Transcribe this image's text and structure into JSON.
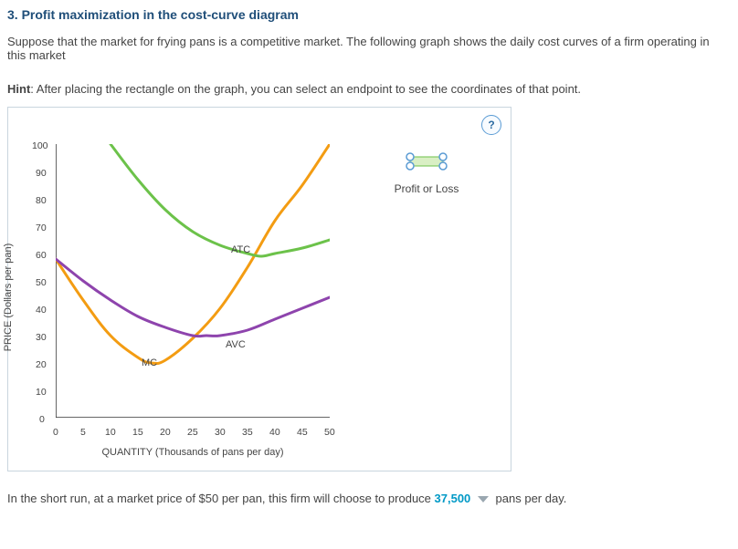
{
  "heading": "3. Profit maximization in the cost-curve diagram",
  "intro": "Suppose that the market for frying pans is a competitive market. The following graph shows the daily cost curves of a firm operating in this market",
  "hint_label": "Hint",
  "hint_text": ": After placing the rectangle on the graph, you can select an endpoint to see the coordinates of that point.",
  "help_symbol": "?",
  "axis": {
    "y_title": "PRICE (Dollars per pan)",
    "x_title": "QUANTITY (Thousands of pans per day)",
    "y_ticks": [
      "0",
      "10",
      "20",
      "30",
      "40",
      "50",
      "60",
      "70",
      "80",
      "90",
      "100"
    ],
    "x_ticks": [
      "0",
      "5",
      "10",
      "15",
      "20",
      "25",
      "30",
      "35",
      "40",
      "45",
      "50"
    ]
  },
  "curve_labels": {
    "atc": "ATC",
    "avc": "AVC",
    "mc": "MC"
  },
  "legend": {
    "label": "Profit or Loss"
  },
  "answer": {
    "prefix": "In the short run, at a market price of $50 per pan, this firm will choose to produce ",
    "value": "37,500",
    "suffix": " pans per day."
  },
  "chart_data": {
    "type": "line",
    "xlabel": "QUANTITY (Thousands of pans per day)",
    "ylabel": "PRICE (Dollars per pan)",
    "xlim": [
      0,
      50
    ],
    "ylim": [
      0,
      100
    ],
    "series": [
      {
        "name": "MC",
        "color": "#f39c12",
        "x": [
          0,
          5,
          10,
          15,
          17.5,
          20,
          25,
          30,
          35,
          40,
          45,
          50
        ],
        "values": [
          58,
          43,
          30,
          22,
          20,
          21,
          29,
          40,
          55,
          72,
          85,
          100
        ]
      },
      {
        "name": "ATC",
        "color": "#6cc24a",
        "x": [
          10,
          15,
          20,
          25,
          30,
          35,
          37.5,
          40,
          45,
          50
        ],
        "values": [
          100,
          87,
          76,
          68,
          63,
          60,
          59,
          60,
          62,
          65
        ]
      },
      {
        "name": "AVC",
        "color": "#8e44ad",
        "x": [
          0,
          5,
          10,
          15,
          20,
          25,
          27.5,
          30,
          35,
          40,
          45,
          50
        ],
        "values": [
          58,
          50,
          43,
          37,
          33,
          30,
          30,
          30,
          32,
          36,
          40,
          44
        ]
      }
    ]
  }
}
